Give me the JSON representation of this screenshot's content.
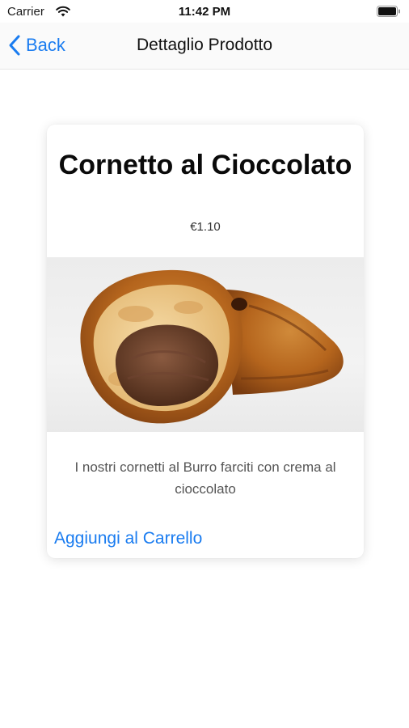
{
  "status_bar": {
    "carrier": "Carrier",
    "time": "11:42 PM"
  },
  "nav": {
    "back_label": "Back",
    "title": "Dettaglio Prodotto",
    "back_icon": "chevron-left-icon"
  },
  "product": {
    "title": "Cornetto al Cioccolato",
    "price": "€1.10",
    "image_subject": "chocolate-filled croissant",
    "description": "I nostri cornetti al Burro farciti con crema al cioccolato",
    "add_to_cart_label": "Aggiungi al Carrello"
  },
  "colors": {
    "accent": "#1a7cf0",
    "background": "#ffffff",
    "card": "#ffffff"
  }
}
